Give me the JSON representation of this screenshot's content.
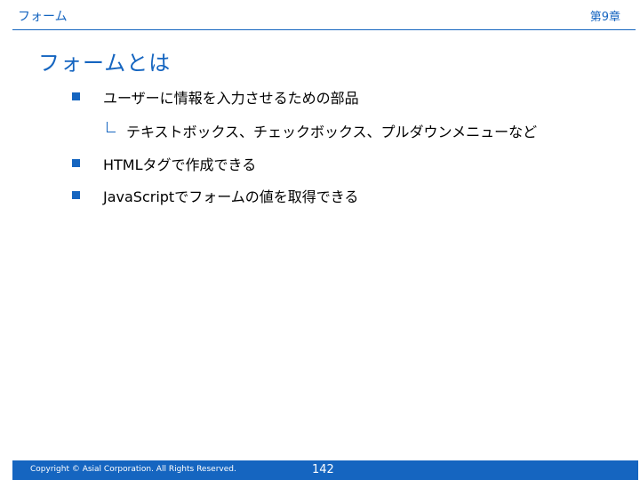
{
  "header": {
    "section": "フォーム",
    "chapter": "第9章"
  },
  "slide": {
    "title": "フォームとは",
    "bullets": [
      {
        "text": "ユーザーに情報を入力させるための部品",
        "sub": "テキストボックス、チェックボックス、プルダウンメニューなど"
      },
      {
        "text": "HTMLタグで作成できる"
      },
      {
        "text": "JavaScriptでフォームの値を取得できる"
      }
    ]
  },
  "footer": {
    "copyright": "Copyright © Asial Corporation. All Rights Reserved.",
    "page": "142"
  },
  "colors": {
    "accent": "#1565C0",
    "text": "#000000",
    "background": "#ffffff"
  }
}
